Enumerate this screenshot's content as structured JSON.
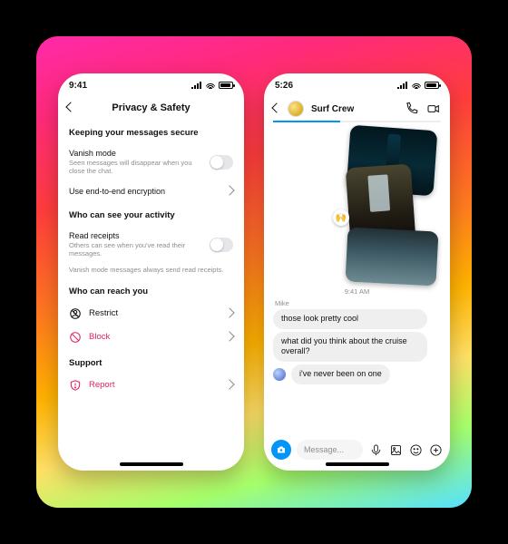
{
  "left": {
    "status_time": "9:41",
    "title": "Privacy & Safety",
    "section_secure": "Keeping your messages secure",
    "vanish": {
      "title": "Vanish mode",
      "sub": "Seen messages will disappear when you close the chat."
    },
    "e2e": {
      "title": "Use end-to-end encryption"
    },
    "section_activity": "Who can see your activity",
    "receipts": {
      "title": "Read receipts",
      "sub": "Others can see when you've read their messages."
    },
    "receipts_note": "Vanish mode messages always send read receipts.",
    "section_reach": "Who can reach you",
    "restrict": "Restrict",
    "block": "Block",
    "section_support": "Support",
    "report": "Report"
  },
  "right": {
    "status_time": "5:26",
    "chat_title": "Surf Crew",
    "timestamp": "9:41 AM",
    "sender": "Mike",
    "msg1": "those look pretty cool",
    "msg2": "what did you think about the cruise overall?",
    "msg3": "i've never been on one",
    "placeholder": "Message...",
    "react_emoji": "🙌"
  }
}
